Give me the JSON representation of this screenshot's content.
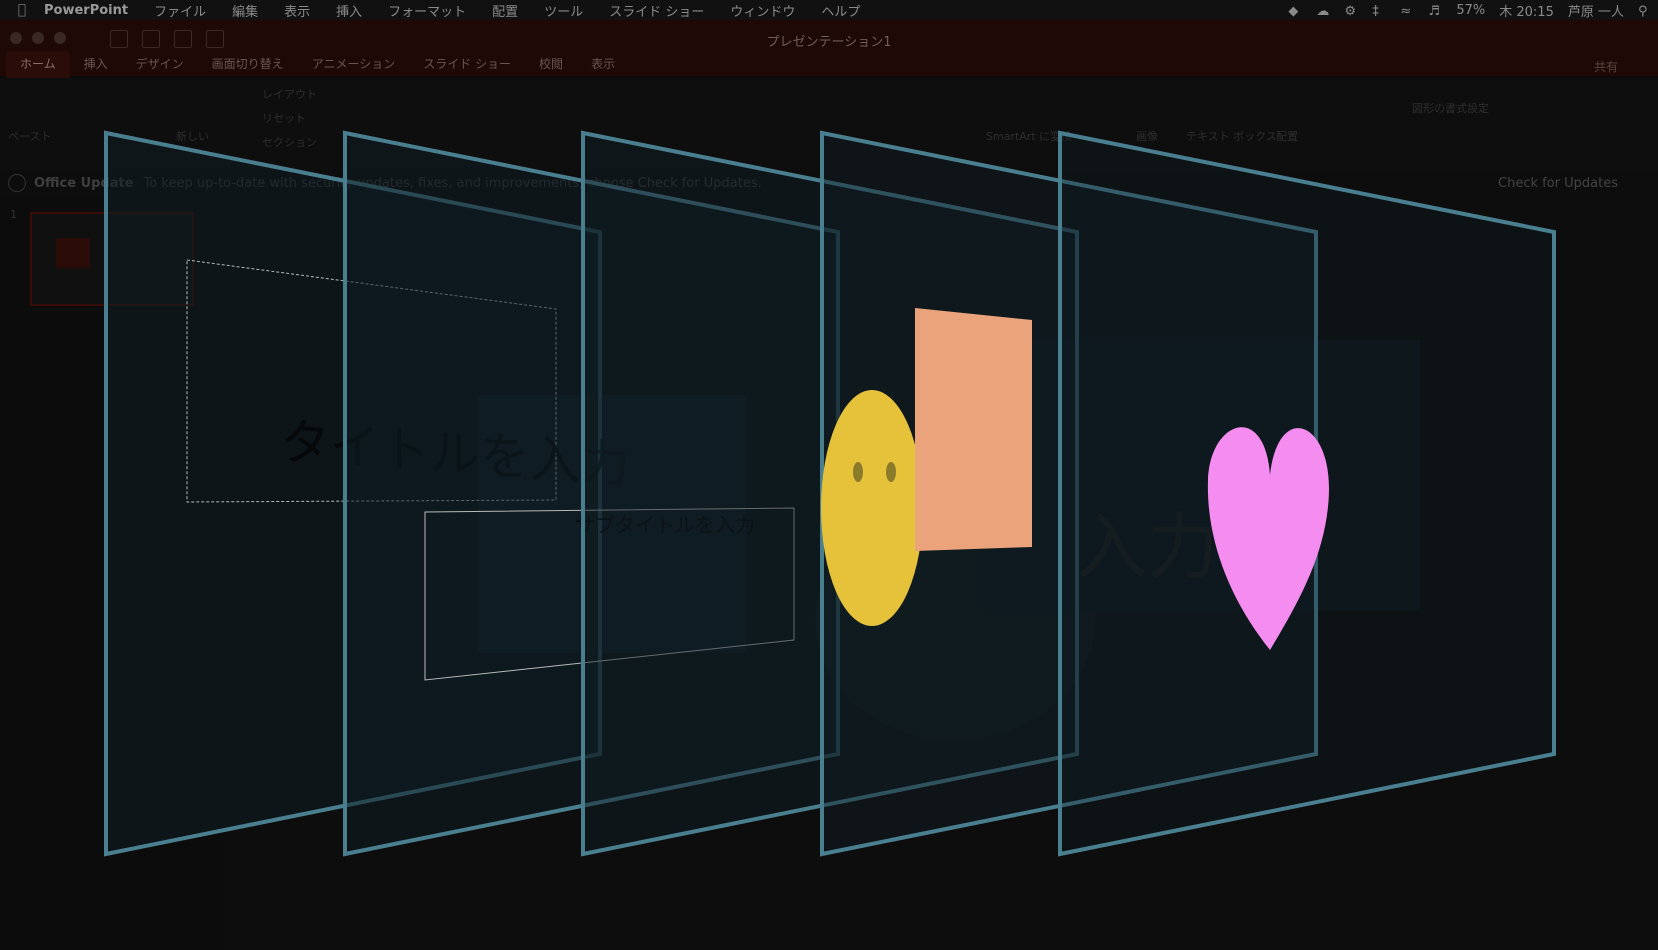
{
  "menubar": {
    "app_name": "PowerPoint",
    "items": [
      "ファイル",
      "編集",
      "表示",
      "挿入",
      "フォーマット",
      "配置",
      "ツール",
      "スライド ショー",
      "ウィンドウ",
      "ヘルプ"
    ],
    "battery": "57%",
    "clock": "木 20:15",
    "user": "芦原 一人"
  },
  "window": {
    "title": "プレゼンテーション1",
    "tabs": [
      "ホーム",
      "挿入",
      "デザイン",
      "画面切り替え",
      "アニメーション",
      "スライド ショー",
      "校閲",
      "表示"
    ],
    "active_tab": "ホーム",
    "share_label": "共有"
  },
  "ribbon": {
    "paste_label": "ペースト",
    "new_slide_label": "新しい",
    "layout_label": "レイアウト",
    "reset_label": "リセット",
    "section_label": "セクション",
    "smartart_label": "SmartArt に変換",
    "picture_label": "画像",
    "textbox_label": "テキスト ボックス",
    "arrange_label": "配置",
    "shape_format_label": "図形の書式設定"
  },
  "notice": {
    "title": "Office Update",
    "message": "To keep up-to-date with security updates, fixes, and improvements, choose Check for Updates.",
    "button": "Check for Updates"
  },
  "slide_panel": {
    "slide_number": "1"
  },
  "layers": {
    "title_placeholder": "タイトルを入力",
    "subtitle_placeholder": "サブタイトルを入力",
    "ghost_title": "入力"
  },
  "colors": {
    "layer_edge": "#4a7f90",
    "layer_fill": "#0f1d24",
    "smiley": "#e6c23a",
    "rectangle": "#eba37b",
    "heart": "#f58cef",
    "title_bar": "#1e0906"
  }
}
